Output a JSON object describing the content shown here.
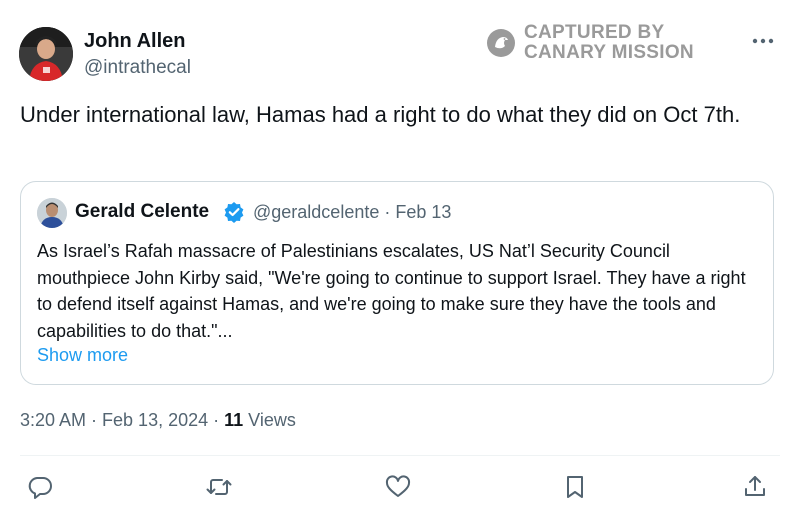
{
  "author": {
    "name": "John Allen",
    "handle": "@intrathecal"
  },
  "watermark": {
    "line1": "CAPTURED BY",
    "line2": "CANARY MISSION"
  },
  "tweet": {
    "text": "Under international law, Hamas had a right to do what they did on Oct 7th."
  },
  "quote": {
    "name": "Gerald Celente",
    "handle_date": "@geraldcelente · Feb 13",
    "text": "As Israel’s Rafah massacre of Palestinians escalates, US Nat’l Security Council mouthpiece John Kirby said, \"We're going to continue to support Israel. They have a right to defend itself against Hamas, and we're going to make sure they have the tools and capabilities to do that.\"...",
    "show_more": "Show more"
  },
  "meta": {
    "timestamp": "3:20 AM · Feb 13, 2024 · ",
    "views_count": "11",
    "views_label": " Views"
  },
  "colors": {
    "verified": "#1d9bf0",
    "link": "#1d9bf0",
    "icon": "#536471"
  },
  "actions": [
    "reply-icon",
    "retweet-icon",
    "like-icon",
    "bookmark-icon",
    "share-icon"
  ]
}
